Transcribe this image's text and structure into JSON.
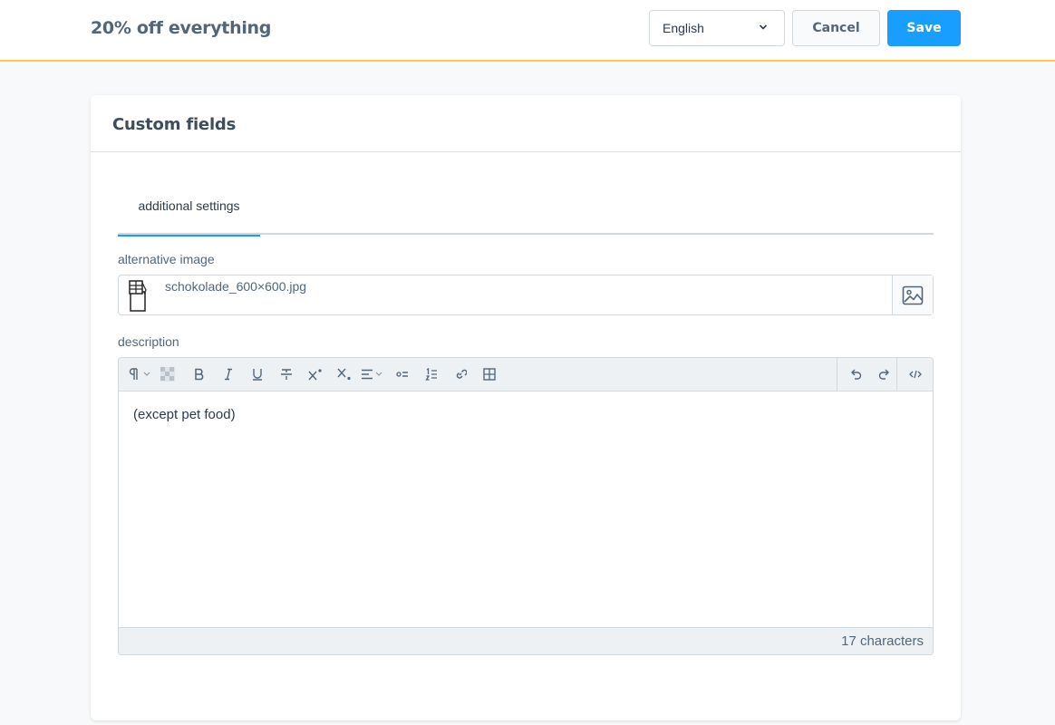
{
  "header": {
    "title": "20% off everything",
    "language": "English",
    "cancel_label": "Cancel",
    "save_label": "Save",
    "accent_color": "#ffc84a",
    "save_color": "#189eff"
  },
  "card": {
    "title": "Custom fields",
    "tabs": [
      {
        "label": "additional settings",
        "active": true
      }
    ]
  },
  "fields": {
    "image_label": "alternative image",
    "image_file": "schokolade_600×600.jpg",
    "description_label": "description",
    "description_text": "(except pet food)",
    "char_count": "17 characters"
  },
  "toolbar": {
    "icons": [
      "paragraph-icon",
      "text-color-icon",
      "bold-icon",
      "italic-icon",
      "underline-icon",
      "strikethrough-icon",
      "superscript-icon",
      "subscript-icon",
      "align-icon",
      "bullet-list-icon",
      "numbered-list-icon",
      "link-icon",
      "table-icon",
      "undo-icon",
      "redo-icon",
      "code-view-icon"
    ]
  }
}
